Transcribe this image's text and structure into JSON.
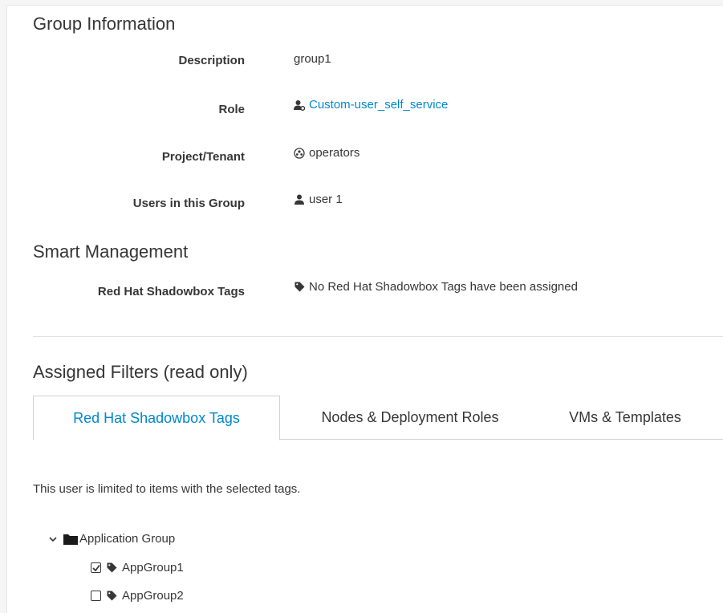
{
  "group_info": {
    "title": "Group Information",
    "rows": [
      {
        "label": "Description",
        "value": "group1"
      },
      {
        "label": "Role",
        "value": "Custom-user_self_service"
      },
      {
        "label": "Project/Tenant",
        "value": "operators"
      },
      {
        "label": "Users in this Group",
        "value": "user 1"
      }
    ]
  },
  "smart_management": {
    "title": "Smart Management",
    "label": "Red Hat Shadowbox Tags",
    "value": "No Red Hat Shadowbox Tags have been assigned"
  },
  "filters": {
    "title": "Assigned Filters (read only)",
    "tabs": [
      {
        "label": "Red Hat Shadowbox Tags",
        "active": true
      },
      {
        "label": "Nodes & Deployment Roles",
        "active": false
      },
      {
        "label": "VMs & Templates",
        "active": false
      }
    ],
    "note": "This user is limited to items with the selected tags.",
    "tree": {
      "root_label": "Application Group",
      "children": [
        {
          "label": "AppGroup1",
          "checked": true
        },
        {
          "label": "AppGroup2",
          "checked": false
        }
      ]
    }
  },
  "colors": {
    "link": "#0088ce",
    "text": "#363636",
    "border": "#d1d1d1"
  }
}
